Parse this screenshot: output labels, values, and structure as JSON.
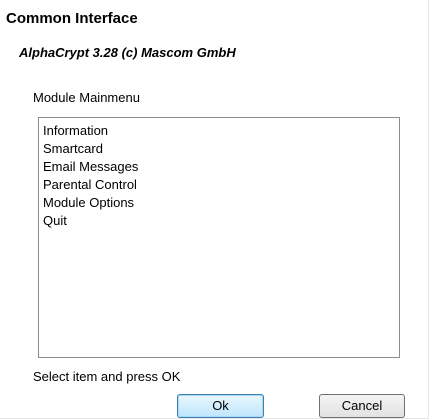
{
  "window": {
    "title": "Common Interface"
  },
  "module": {
    "info": "AlphaCrypt 3.28 (c) Mascom GmbH",
    "menu_title": "Module Mainmenu"
  },
  "menu": {
    "items": [
      {
        "label": "Information"
      },
      {
        "label": "Smartcard"
      },
      {
        "label": "Email Messages"
      },
      {
        "label": "Parental Control"
      },
      {
        "label": "Module Options"
      },
      {
        "label": "Quit"
      }
    ]
  },
  "footer": {
    "instruction": "Select item and press OK",
    "ok_label": "Ok",
    "cancel_label": "Cancel"
  }
}
